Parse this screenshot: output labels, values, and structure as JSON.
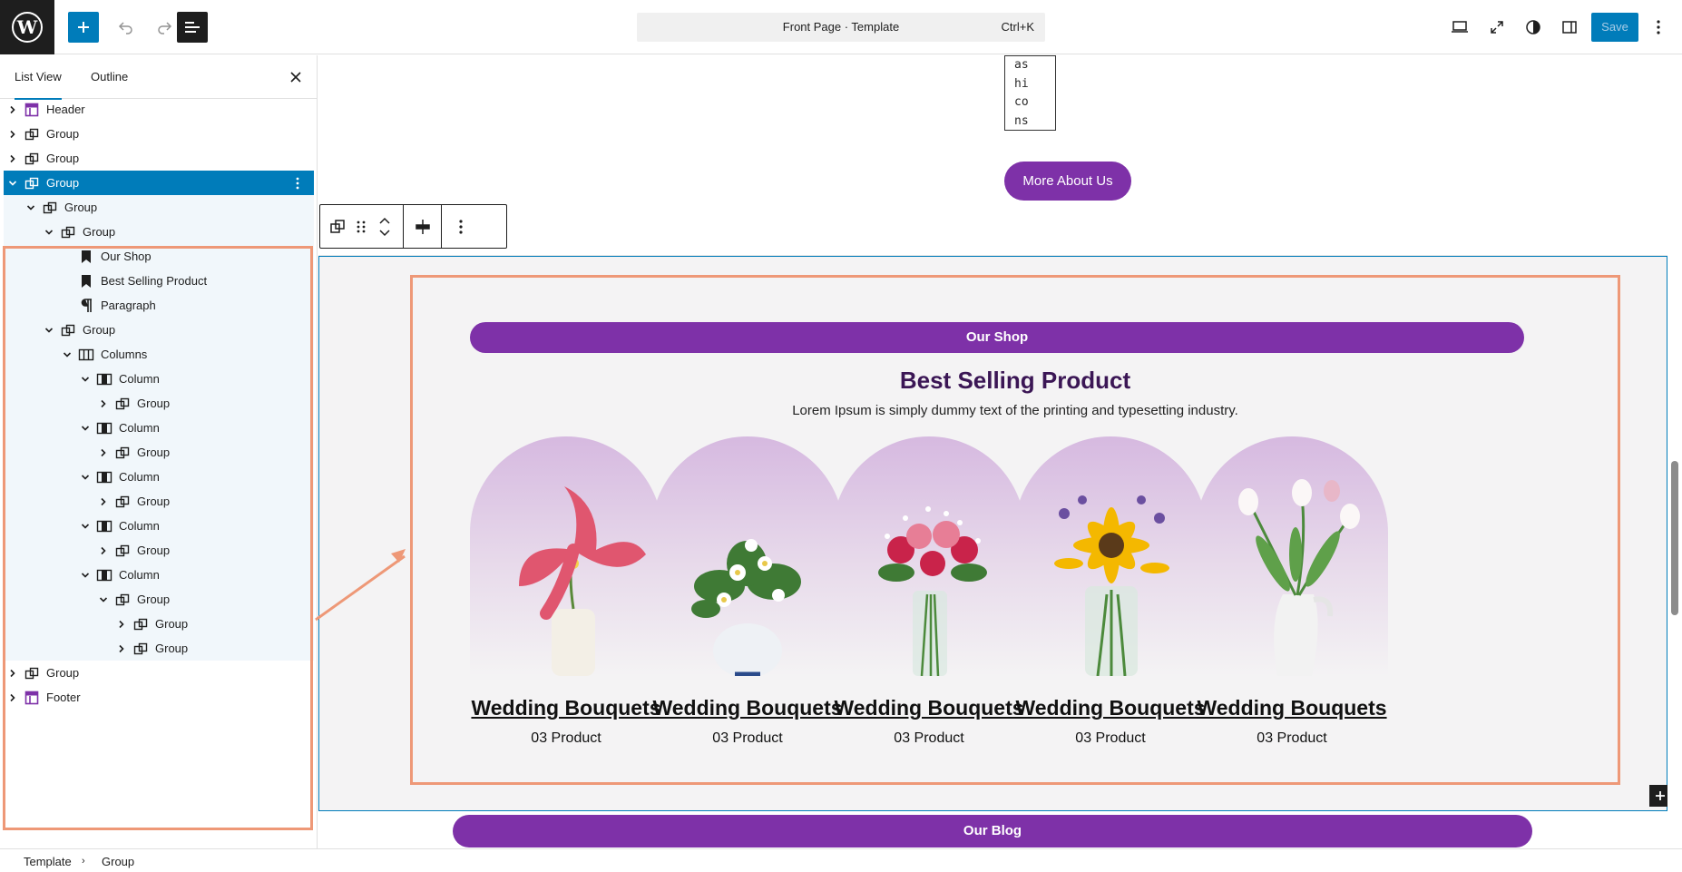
{
  "topbar": {
    "doc_title": "Front Page · Template",
    "shortcut": "Ctrl+K",
    "save_label": "Save",
    "icons": [
      "wordpress-logo",
      "plus-icon",
      "undo-icon",
      "redo-icon",
      "list-view-icon",
      "desktop-view-icon",
      "fullscreen-icon",
      "styles-icon",
      "sidebar-icon",
      "more-icon"
    ]
  },
  "list_view": {
    "tabs": [
      "List View",
      "Outline"
    ],
    "active_tab": "List View",
    "items": [
      {
        "label": "Header",
        "icon": "template-part-icon",
        "depth": 0,
        "expanded": false
      },
      {
        "label": "Group",
        "icon": "group-icon",
        "depth": 0,
        "expanded": false
      },
      {
        "label": "Group",
        "icon": "group-icon",
        "depth": 0,
        "expanded": false
      },
      {
        "label": "Group",
        "icon": "group-icon",
        "depth": 0,
        "expanded": true,
        "selected": true
      },
      {
        "label": "Group",
        "icon": "group-icon",
        "depth": 1,
        "expanded": true
      },
      {
        "label": "Group",
        "icon": "group-icon",
        "depth": 2,
        "expanded": true
      },
      {
        "label": "Our Shop",
        "icon": "bookmark-icon",
        "depth": 3
      },
      {
        "label": "Best Selling Product",
        "icon": "bookmark-icon",
        "depth": 3
      },
      {
        "label": "Paragraph",
        "icon": "paragraph-icon",
        "depth": 3
      },
      {
        "label": "Group",
        "icon": "group-icon",
        "depth": 2,
        "expanded": true
      },
      {
        "label": "Columns",
        "icon": "columns-icon",
        "depth": 3,
        "expanded": true
      },
      {
        "label": "Column",
        "icon": "column-icon",
        "depth": 4,
        "expanded": true
      },
      {
        "label": "Group",
        "icon": "group-icon",
        "depth": 5,
        "expanded": false
      },
      {
        "label": "Column",
        "icon": "column-icon",
        "depth": 4,
        "expanded": true
      },
      {
        "label": "Group",
        "icon": "group-icon",
        "depth": 5,
        "expanded": false
      },
      {
        "label": "Column",
        "icon": "column-icon",
        "depth": 4,
        "expanded": true
      },
      {
        "label": "Group",
        "icon": "group-icon",
        "depth": 5,
        "expanded": false
      },
      {
        "label": "Column",
        "icon": "column-icon",
        "depth": 4,
        "expanded": true
      },
      {
        "label": "Group",
        "icon": "group-icon",
        "depth": 5,
        "expanded": false
      },
      {
        "label": "Column",
        "icon": "column-icon",
        "depth": 4,
        "expanded": true
      },
      {
        "label": "Group",
        "icon": "group-icon",
        "depth": 5,
        "expanded": true
      },
      {
        "label": "Group",
        "icon": "group-icon",
        "depth": 6,
        "expanded": false
      },
      {
        "label": "Group",
        "icon": "group-icon",
        "depth": 6,
        "expanded": false
      },
      {
        "label": "Group",
        "icon": "group-icon",
        "depth": 0,
        "expanded": false
      },
      {
        "label": "Footer",
        "icon": "template-part-icon",
        "depth": 0,
        "expanded": false
      }
    ]
  },
  "canvas": {
    "textarea_lines": [
      "as",
      "hi",
      "co",
      "ns"
    ],
    "more_about_label": "More About Us",
    "shop_pill": "Our Shop",
    "heading": "Best Selling Product",
    "subtext": "Lorem Ipsum is simply dummy text of the printing and typesetting industry.",
    "products": [
      {
        "title": "Wedding Bouquets",
        "count": "03 Product",
        "flower": "pink-tulip"
      },
      {
        "title": "Wedding Bouquets",
        "count": "03 Product",
        "flower": "white-anemone"
      },
      {
        "title": "Wedding Bouquets",
        "count": "03 Product",
        "flower": "red-roses"
      },
      {
        "title": "Wedding Bouquets",
        "count": "03 Product",
        "flower": "yellow-sunflower"
      },
      {
        "title": "Wedding Bouquets",
        "count": "03 Product",
        "flower": "white-tulips"
      }
    ],
    "blog_pill": "Our Blog"
  },
  "breadcrumb": [
    "Template",
    "Group"
  ],
  "colors": {
    "accent": "#007cba",
    "brand_purple": "#7e31a8",
    "heading_purple": "#3b1655",
    "highlight": "#ee9877"
  }
}
